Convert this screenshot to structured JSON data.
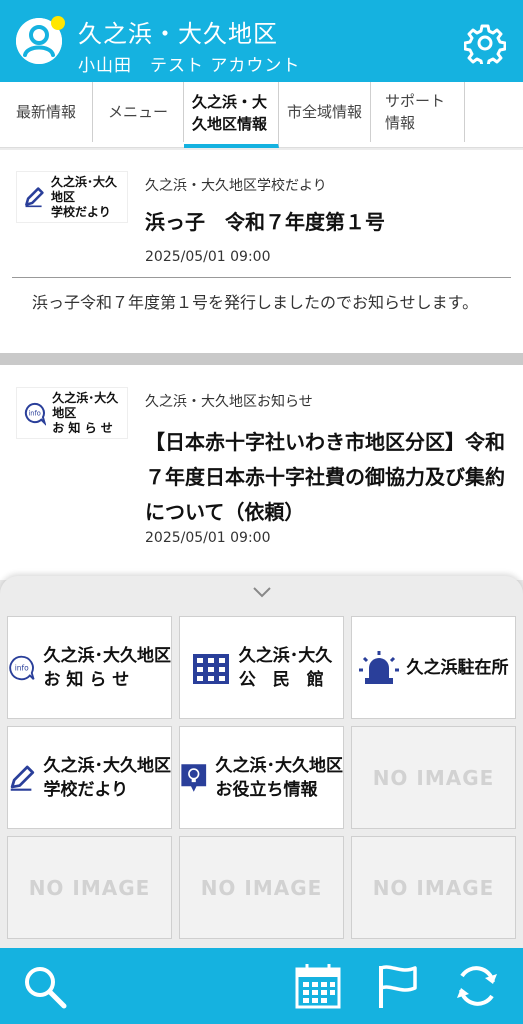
{
  "header": {
    "title": "久之浜・大久地区",
    "subtitle": "小山田　テスト アカウント",
    "avatar_icon": "user-avatar-icon",
    "settings_icon": "gear-icon",
    "accent_color": "#15b2e0"
  },
  "tabs": [
    {
      "label": "最新情報"
    },
    {
      "label": "メニュー"
    },
    {
      "label": "久之浜・大久地区情報",
      "active": true
    },
    {
      "label": "市全域情報"
    },
    {
      "label": "サポート情報"
    }
  ],
  "posts": [
    {
      "thumb_label_1": "久之浜･大久地区",
      "thumb_label_2": "学校だより",
      "thumb_icon": "pencil-icon",
      "category": "久之浜・大久地区学校だより",
      "title": "浜っ子　令和７年度第１号",
      "date": "2025/05/01 09:00",
      "body": "浜っ子令和７年度第１号を発行しましたのでお知らせします。"
    },
    {
      "thumb_label_1": "久之浜･大久地区",
      "thumb_label_2": "お 知 ら せ",
      "thumb_icon": "info-icon",
      "category": "久之浜・大久地区お知らせ",
      "title": "【日本赤十字社いわき市地区分区】令和７年度日本赤十字社費の御協力及び集約について（依頼）",
      "date": "2025/05/01 09:00"
    }
  ],
  "sheet": {
    "collapse_icon": "chevron-down-icon",
    "tiles": [
      {
        "icon": "info-icon",
        "line1": "久之浜･大久地区",
        "line2": "お 知 ら せ"
      },
      {
        "icon": "building-icon",
        "line1": "久之浜･大久",
        "line2": "公　民　館"
      },
      {
        "icon": "siren-icon",
        "line1": "久之浜駐在所",
        "line2": ""
      },
      {
        "icon": "pencil-icon",
        "line1": "久之浜･大久地区",
        "line2": "学校だより"
      },
      {
        "icon": "lightbulb-icon",
        "line1": "久之浜･大久地区",
        "line2": "お役立ち情報"
      },
      {
        "noimage": "NO IMAGE"
      },
      {
        "noimage": "NO IMAGE"
      },
      {
        "noimage": "NO IMAGE"
      },
      {
        "noimage": "NO IMAGE"
      }
    ]
  },
  "bottombar": {
    "icons": [
      "search-icon",
      "calendar-icon",
      "flag-icon",
      "refresh-icon"
    ]
  }
}
